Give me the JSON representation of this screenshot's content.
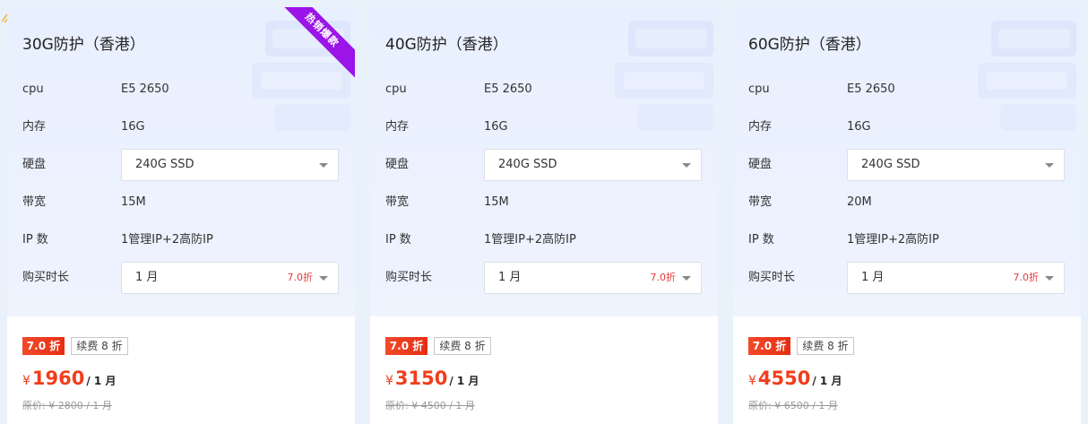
{
  "labels": {
    "cpu": "cpu",
    "memory": "内存",
    "disk": "硬盘",
    "bandwidth": "带宽",
    "ip": "IP 数",
    "duration": "购买时长"
  },
  "colors": {
    "accent": "#f23d1c",
    "ribbon": "#9b14e8",
    "card_top": "#e8effe"
  },
  "cards": [
    {
      "title": "30G防护（香港）",
      "ribbon": "热销爆款",
      "cpu": "E5 2650",
      "memory": "16G",
      "disk": "240G SSD",
      "bandwidth": "15M",
      "ip": "1管理IP+2高防IP",
      "duration": "1 月",
      "duration_tag": "7.0折",
      "discount_badge": "7.0 折",
      "renew_badge": "续费 8 折",
      "currency": "¥",
      "price": "1960",
      "price_unit": "/ 1 月",
      "original_price": "原价: ¥ 2800 / 1 月"
    },
    {
      "title": "40G防护（香港）",
      "cpu": "E5 2650",
      "memory": "16G",
      "disk": "240G SSD",
      "bandwidth": "15M",
      "ip": "1管理IP+2高防IP",
      "duration": "1 月",
      "duration_tag": "7.0折",
      "discount_badge": "7.0 折",
      "renew_badge": "续费 8 折",
      "currency": "¥",
      "price": "3150",
      "price_unit": "/ 1 月",
      "original_price": "原价: ¥ 4500 / 1 月"
    },
    {
      "title": "60G防护（香港）",
      "cpu": "E5 2650",
      "memory": "16G",
      "disk": "240G SSD",
      "bandwidth": "20M",
      "ip": "1管理IP+2高防IP",
      "duration": "1 月",
      "duration_tag": "7.0折",
      "discount_badge": "7.0 折",
      "renew_badge": "续费 8 折",
      "currency": "¥",
      "price": "4550",
      "price_unit": "/ 1 月",
      "original_price": "原价: ¥ 6500 / 1 月"
    }
  ]
}
